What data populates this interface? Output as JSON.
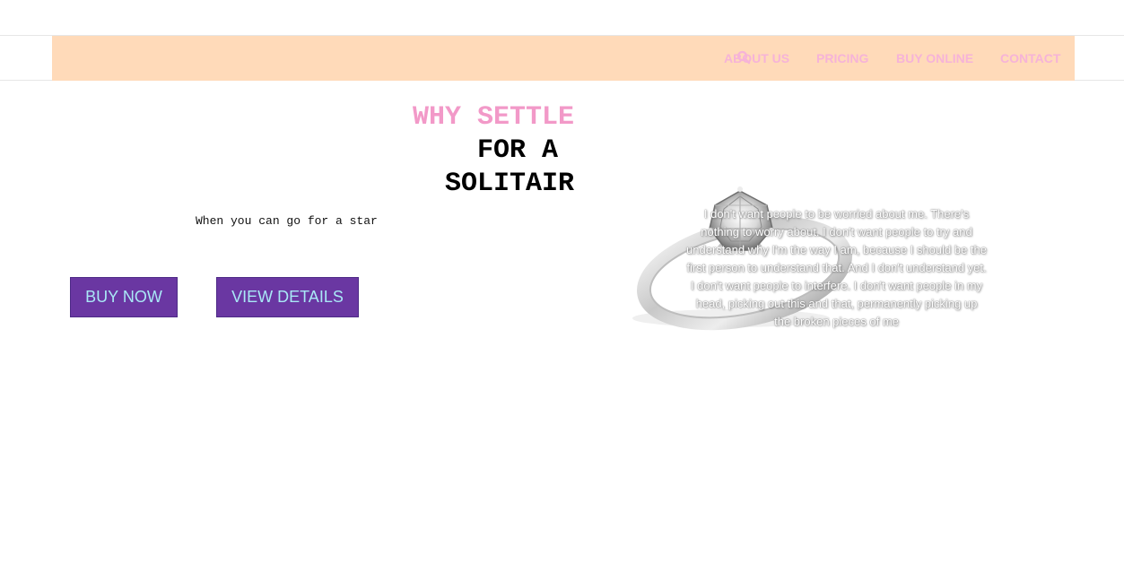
{
  "nav": {
    "search_icon": "search-icon",
    "links": [
      "ABOUT US",
      "PRICING",
      "BUY ONLINE",
      "CONTACT"
    ]
  },
  "hero": {
    "headline_line1": "WHY SETTLE",
    "headline_line2": "FOR A",
    "headline_line3": "SOLITAIR",
    "tagline": "When you can go for a star",
    "buy_button": "BUY NOW",
    "details_button": "VIEW DETAILS"
  },
  "ring": {
    "caption": "I don't want people to be worried about me. There's nothing to worry about. I don't want people to try and understand why I'm the way I am, because I should be the first person to understand that. And I don't understand yet. I don't want people to interfere. I don't want people in my head, picking out this and that, permanently picking up the broken pieces of me"
  },
  "colors": {
    "nav_background": "#ffdab9",
    "nav_link": "#f6b3d8",
    "headline_accent": "#f299c8",
    "button_background": "#6a37a2",
    "button_text": "#a9e8f6"
  }
}
